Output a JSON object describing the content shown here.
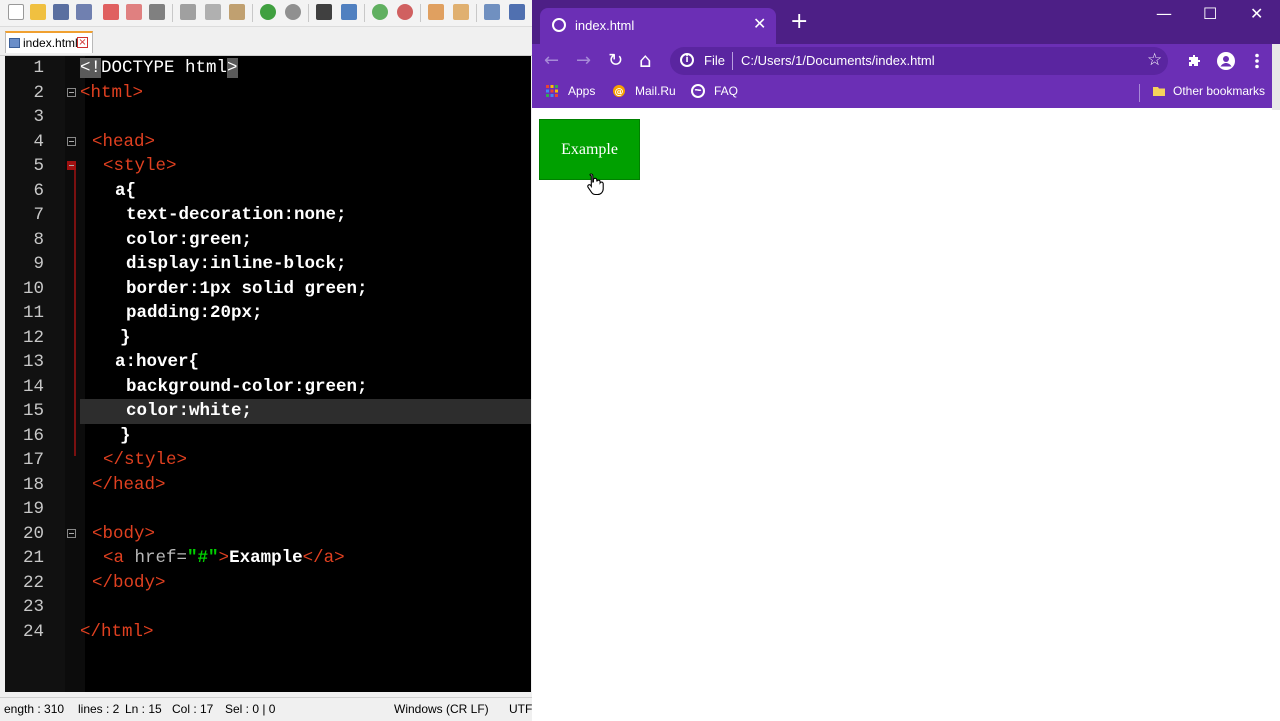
{
  "editor": {
    "tab_label": "index.html",
    "lines": [
      {
        "n": "1"
      },
      {
        "n": "2"
      },
      {
        "n": "3"
      },
      {
        "n": "4"
      },
      {
        "n": "5"
      },
      {
        "n": "6"
      },
      {
        "n": "7"
      },
      {
        "n": "8"
      },
      {
        "n": "9"
      },
      {
        "n": "10"
      },
      {
        "n": "11"
      },
      {
        "n": "12"
      },
      {
        "n": "13"
      },
      {
        "n": "14"
      },
      {
        "n": "15"
      },
      {
        "n": "16"
      },
      {
        "n": "17"
      },
      {
        "n": "18"
      },
      {
        "n": "19"
      },
      {
        "n": "20"
      },
      {
        "n": "21"
      },
      {
        "n": "22"
      },
      {
        "n": "23"
      },
      {
        "n": "24"
      }
    ],
    "code": {
      "l1a": "<!",
      "l1b": "DOCTYPE html",
      "l1c": ">",
      "l2": "<html>",
      "l4": "<head>",
      "l5": "<style>",
      "l6": "a{",
      "l7": "text-decoration:none;",
      "l8": "color:green;",
      "l9": "display:inline-block;",
      "l10": "border:1px solid green;",
      "l11": "padding:20px;",
      "l12": "}",
      "l13": "a:hover{",
      "l14": "background-color:green;",
      "l15": "color:white;",
      "l16": "}",
      "l17": "</style>",
      "l18": "</head>",
      "l20": "<body>",
      "l21_open": "<a",
      "l21_attr": " href=",
      "l21_val": "\"#\"",
      "l21_gt": ">",
      "l21_text": "Example",
      "l21_close": "</a>",
      "l22": "</body>",
      "l24": "</html>"
    },
    "status": {
      "length": "ength : 310",
      "lines": "lines : 2",
      "ln": "Ln : 15",
      "col": "Col : 17",
      "sel": "Sel : 0 | 0",
      "eol": "Windows (CR LF)",
      "enc": "UTF-"
    }
  },
  "browser": {
    "tab_title": "index.html",
    "tab_close": "✕",
    "new_tab": "+",
    "minimize": "—",
    "maximize": "☐",
    "close": "✕",
    "back": "←",
    "forward": "→",
    "reload": "↻",
    "home": "⌂",
    "omnibox": {
      "info": "i",
      "file_label": "File",
      "url": "C:/Users/1/Documents/index.html",
      "star": "☆"
    },
    "bookmarks": {
      "apps": "Apps",
      "mailru": "Mail.Ru",
      "faq": "FAQ",
      "other": "Other bookmarks"
    },
    "page": {
      "link_text": "Example"
    }
  },
  "colors": {
    "chrome_purple": "#6b2fb5",
    "chrome_tabstrip": "#4d1f86",
    "link_green": "#00a000"
  }
}
